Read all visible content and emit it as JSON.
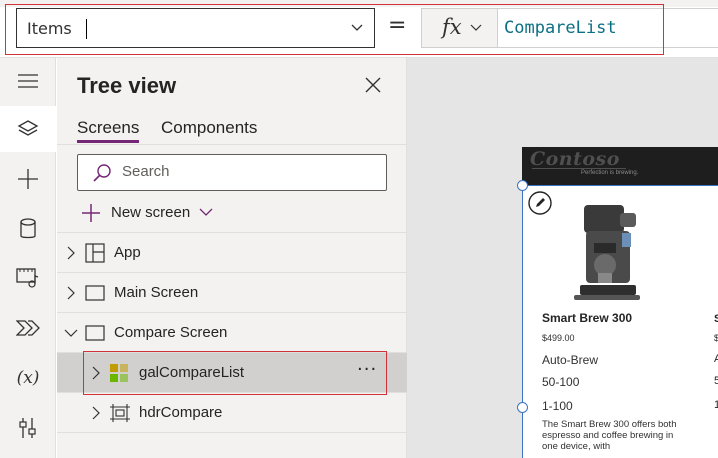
{
  "formula_bar": {
    "property": "Items",
    "equals": "=",
    "fx_label": "fx",
    "formula": "CompareList"
  },
  "rail": {
    "items": [
      {
        "icon": "hamburger-menu-icon"
      },
      {
        "icon": "tree-view-layers-icon",
        "active": true
      },
      {
        "icon": "insert-plus-icon"
      },
      {
        "icon": "data-cylinder-icon"
      },
      {
        "icon": "media-icon"
      },
      {
        "icon": "power-automate-icon"
      },
      {
        "icon": "variables-icon",
        "text": "(x)"
      },
      {
        "icon": "advanced-tools-icon"
      }
    ]
  },
  "tree_view": {
    "title": "Tree view",
    "tabs": [
      {
        "label": "Screens",
        "active": true
      },
      {
        "label": "Components",
        "active": false
      }
    ],
    "search_placeholder": "Search",
    "new_screen_label": "New screen",
    "nodes": [
      {
        "label": "App",
        "icon": "app-icon",
        "expanded": false
      },
      {
        "label": "Main Screen",
        "icon": "screen-icon",
        "expanded": false
      },
      {
        "label": "Compare Screen",
        "icon": "screen-icon",
        "expanded": true
      },
      {
        "label": "galCompareList",
        "icon": "gallery-icon",
        "expanded": false,
        "selected": true
      },
      {
        "label": "hdrCompare",
        "icon": "container-icon",
        "expanded": false
      }
    ],
    "more_label": "···"
  },
  "canvas": {
    "header": {
      "logo": "Contoso",
      "tagline": "Perfection is brewing."
    },
    "product": {
      "name": "Smart Brew 300",
      "price": "$499.00",
      "attr1": "Auto-Brew",
      "attr2": "50-100",
      "attr3": "1-100",
      "description": "The Smart Brew 300 offers both espresso and coffee brewing in one device, with"
    },
    "second_column_partial": [
      "S",
      "$",
      "A",
      "5",
      "1"
    ]
  },
  "colors": {
    "accent": "#742774",
    "highlight": "#d13438",
    "selection": "#3b73c5",
    "formula_text": "#0d6f83"
  }
}
